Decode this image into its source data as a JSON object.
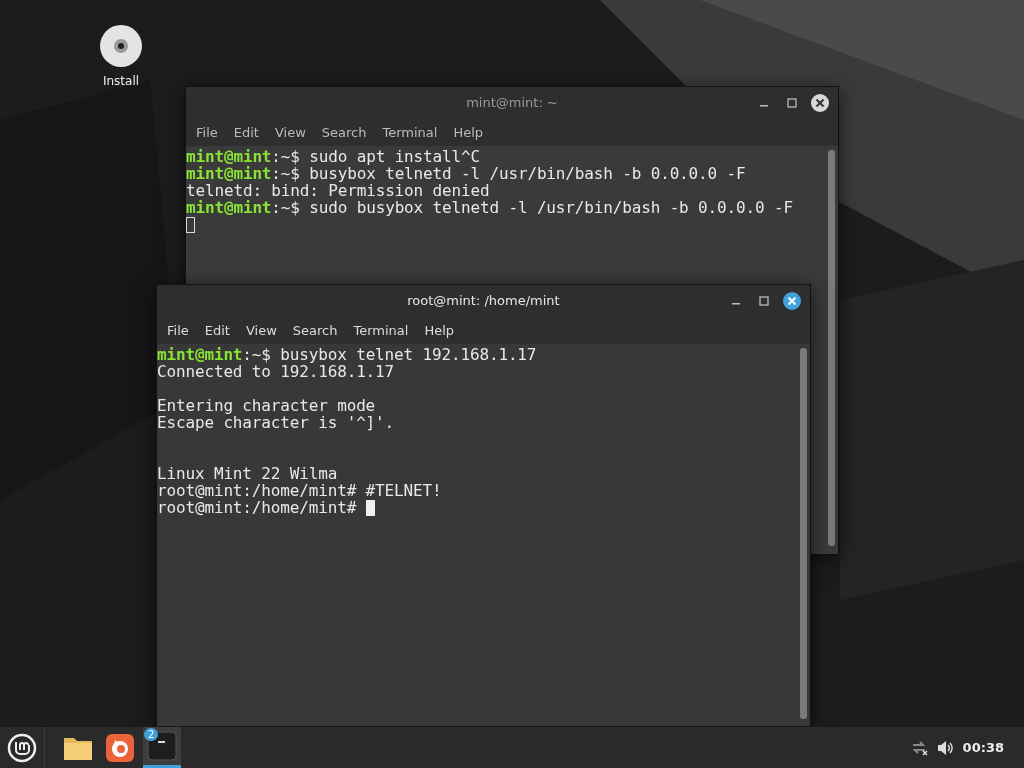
{
  "desktop": {
    "icons": [
      {
        "label": "Install"
      }
    ]
  },
  "windows": [
    {
      "title": "mint@mint: ~",
      "focused": false,
      "menu": [
        "File",
        "Edit",
        "View",
        "Search",
        "Terminal",
        "Help"
      ],
      "lines": [
        {
          "kind": "prompt",
          "user": "mint@mint",
          "text": ":~$ sudo apt install^C"
        },
        {
          "kind": "prompt",
          "user": "mint@mint",
          "text": ":~$ busybox telnetd -l /usr/bin/bash -b 0.0.0.0 -F"
        },
        {
          "kind": "output",
          "text": "telnetd: bind: Permission denied"
        },
        {
          "kind": "prompt",
          "user": "mint@mint",
          "text": ":~$ sudo busybox telnetd -l /usr/bin/bash -b 0.0.0.0 -F"
        },
        {
          "kind": "cursor"
        }
      ]
    },
    {
      "title": "root@mint: /home/mint",
      "focused": true,
      "menu": [
        "File",
        "Edit",
        "View",
        "Search",
        "Terminal",
        "Help"
      ],
      "lines": [
        {
          "kind": "prompt",
          "user": "mint@mint",
          "text": ":~$ busybox telnet 192.168.1.17"
        },
        {
          "kind": "output",
          "text": "Connected to 192.168.1.17"
        },
        {
          "kind": "blank"
        },
        {
          "kind": "output",
          "text": "Entering character mode"
        },
        {
          "kind": "output",
          "text": "Escape character is '^]'."
        },
        {
          "kind": "blank"
        },
        {
          "kind": "blank"
        },
        {
          "kind": "output",
          "text": "Linux Mint 22 Wilma"
        },
        {
          "kind": "output",
          "text": "root@mint:/home/mint# #TELNET!"
        },
        {
          "kind": "output_cursor",
          "text": "root@mint:/home/mint# "
        }
      ]
    }
  ],
  "taskbar": {
    "apps": [
      {
        "kind": "folder",
        "selected": false
      },
      {
        "kind": "browser",
        "selected": false
      },
      {
        "kind": "terminal",
        "selected": true,
        "badge": "2"
      }
    ],
    "clock": "00:38"
  }
}
